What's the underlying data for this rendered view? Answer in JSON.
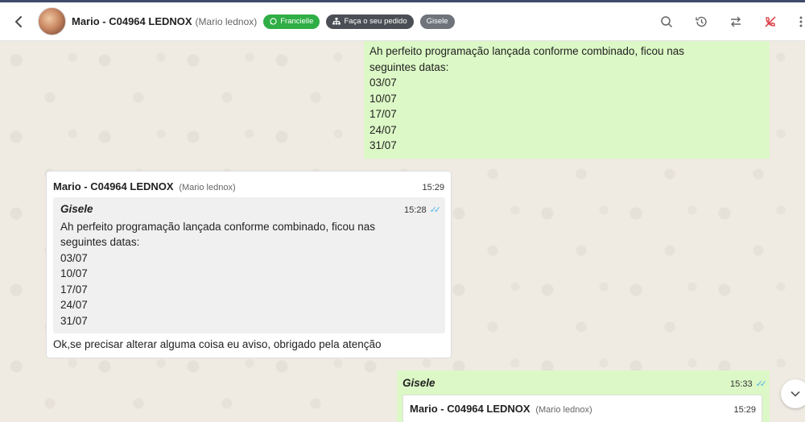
{
  "header": {
    "contact_name": "Mario - C04964 LEDNOX",
    "contact_subtitle": "(Mario lednox)",
    "tags": [
      {
        "label": "Francielle",
        "color": "#2fae45",
        "icon": "whatsapp-icon"
      },
      {
        "label": "Faça o seu pedido",
        "color": "#4b4f55",
        "icon": "sitemap-icon"
      },
      {
        "label": "Gisele",
        "color": "#6f747a"
      }
    ],
    "actions": [
      "search-icon",
      "history-icon",
      "transfer-icon",
      "phone-off-icon",
      "more-icon"
    ]
  },
  "messages": {
    "first_out": {
      "lines": [
        "Ah perfeito programação lançada conforme combinado, ficou nas",
        "seguintes datas:",
        "03/07",
        "10/07",
        "17/07",
        "24/07",
        "31/07"
      ]
    },
    "reply_in": {
      "sender": "Mario - C04964 LEDNOX",
      "sender_sub": "(Mario lednox)",
      "time": "15:29",
      "quote": {
        "sender": "Gisele",
        "time": "15:28",
        "lines": [
          "Ah perfeito programação lançada conforme combinado, ficou nas",
          "seguintes datas:",
          "03/07",
          "10/07",
          "17/07",
          "24/07",
          "31/07"
        ]
      },
      "text": "Ok,se precisar alterar alguma coisa eu aviso, obrigado pela atenção"
    },
    "last_out": {
      "sender": "Gisele",
      "time": "15:33",
      "quote": {
        "sender": "Mario - C04964 LEDNOX",
        "sender_sub": "(Mario lednox)",
        "time": "15:29"
      }
    }
  },
  "colors": {
    "outgoing_bubble": "#dcf8c6",
    "incoming_bubble": "#ffffff",
    "read_check": "#4fb3e8",
    "hangup_icon": "#d9363e"
  }
}
